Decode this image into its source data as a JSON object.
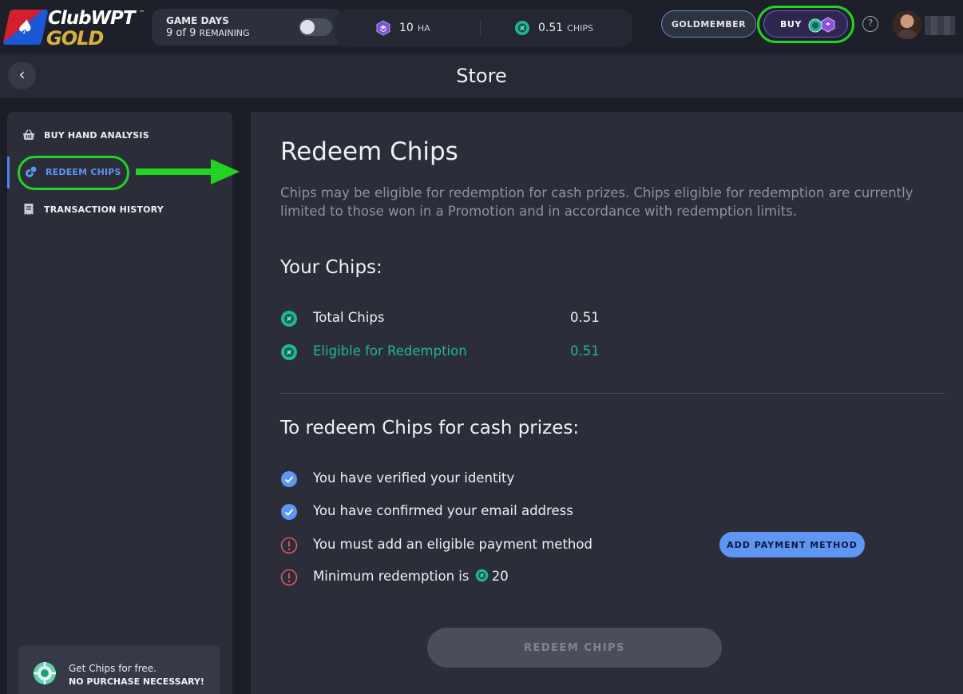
{
  "brand": {
    "top": "ClubWPT",
    "bottom": "GOLD",
    "tm": "™"
  },
  "topbar": {
    "game_days_label": "GAME DAYS",
    "game_days_count": "9 of 9",
    "game_days_suffix": "REMAINING",
    "ha_value": "10",
    "ha_unit": "HA",
    "chips_value": "0.51",
    "chips_unit": "CHIPS",
    "goldmember_label": "GOLDMEMBER",
    "buy_label": "BUY",
    "help_label": "?"
  },
  "titlebar": {
    "title": "Store",
    "back_icon": "‹"
  },
  "sidebar": {
    "items": [
      {
        "label": "BUY HAND ANALYSIS",
        "icon": "basket-icon"
      },
      {
        "label": "REDEEM CHIPS",
        "icon": "chips-icon"
      },
      {
        "label": "TRANSACTION HISTORY",
        "icon": "receipt-icon"
      }
    ],
    "promo_line1": "Get Chips for free.",
    "promo_line2": "NO PURCHASE NECESSARY!"
  },
  "main": {
    "heading": "Redeem Chips",
    "description": "Chips may be eligible for redemption for cash prizes. Chips eligible for redemption are currently limited to those won in a Promotion and in accordance with redemption limits.",
    "your_chips_heading": "Your Chips:",
    "total_label": "Total Chips",
    "total_value": "0.51",
    "eligible_label": "Eligible for Redemption",
    "eligible_value": "0.51",
    "redeem_heading": "To redeem Chips for cash prizes:",
    "requirements": [
      {
        "text": "You have verified your identity",
        "status": "done"
      },
      {
        "text": "You have confirmed your email address",
        "status": "done"
      },
      {
        "text": "You must add an eligible payment method",
        "status": "error"
      },
      {
        "text": "Minimum redemption is",
        "status": "error",
        "amount": "20"
      }
    ],
    "add_payment_label": "ADD PAYMENT METHOD",
    "redeem_button_label": "REDEEM CHIPS"
  },
  "colors": {
    "background": "#1b1e26",
    "panel": "#2b2e38",
    "accent_blue": "#5d96f5",
    "chip_green": "#1fb597",
    "error_red": "#e05560",
    "highlight_green": "#22d322"
  }
}
